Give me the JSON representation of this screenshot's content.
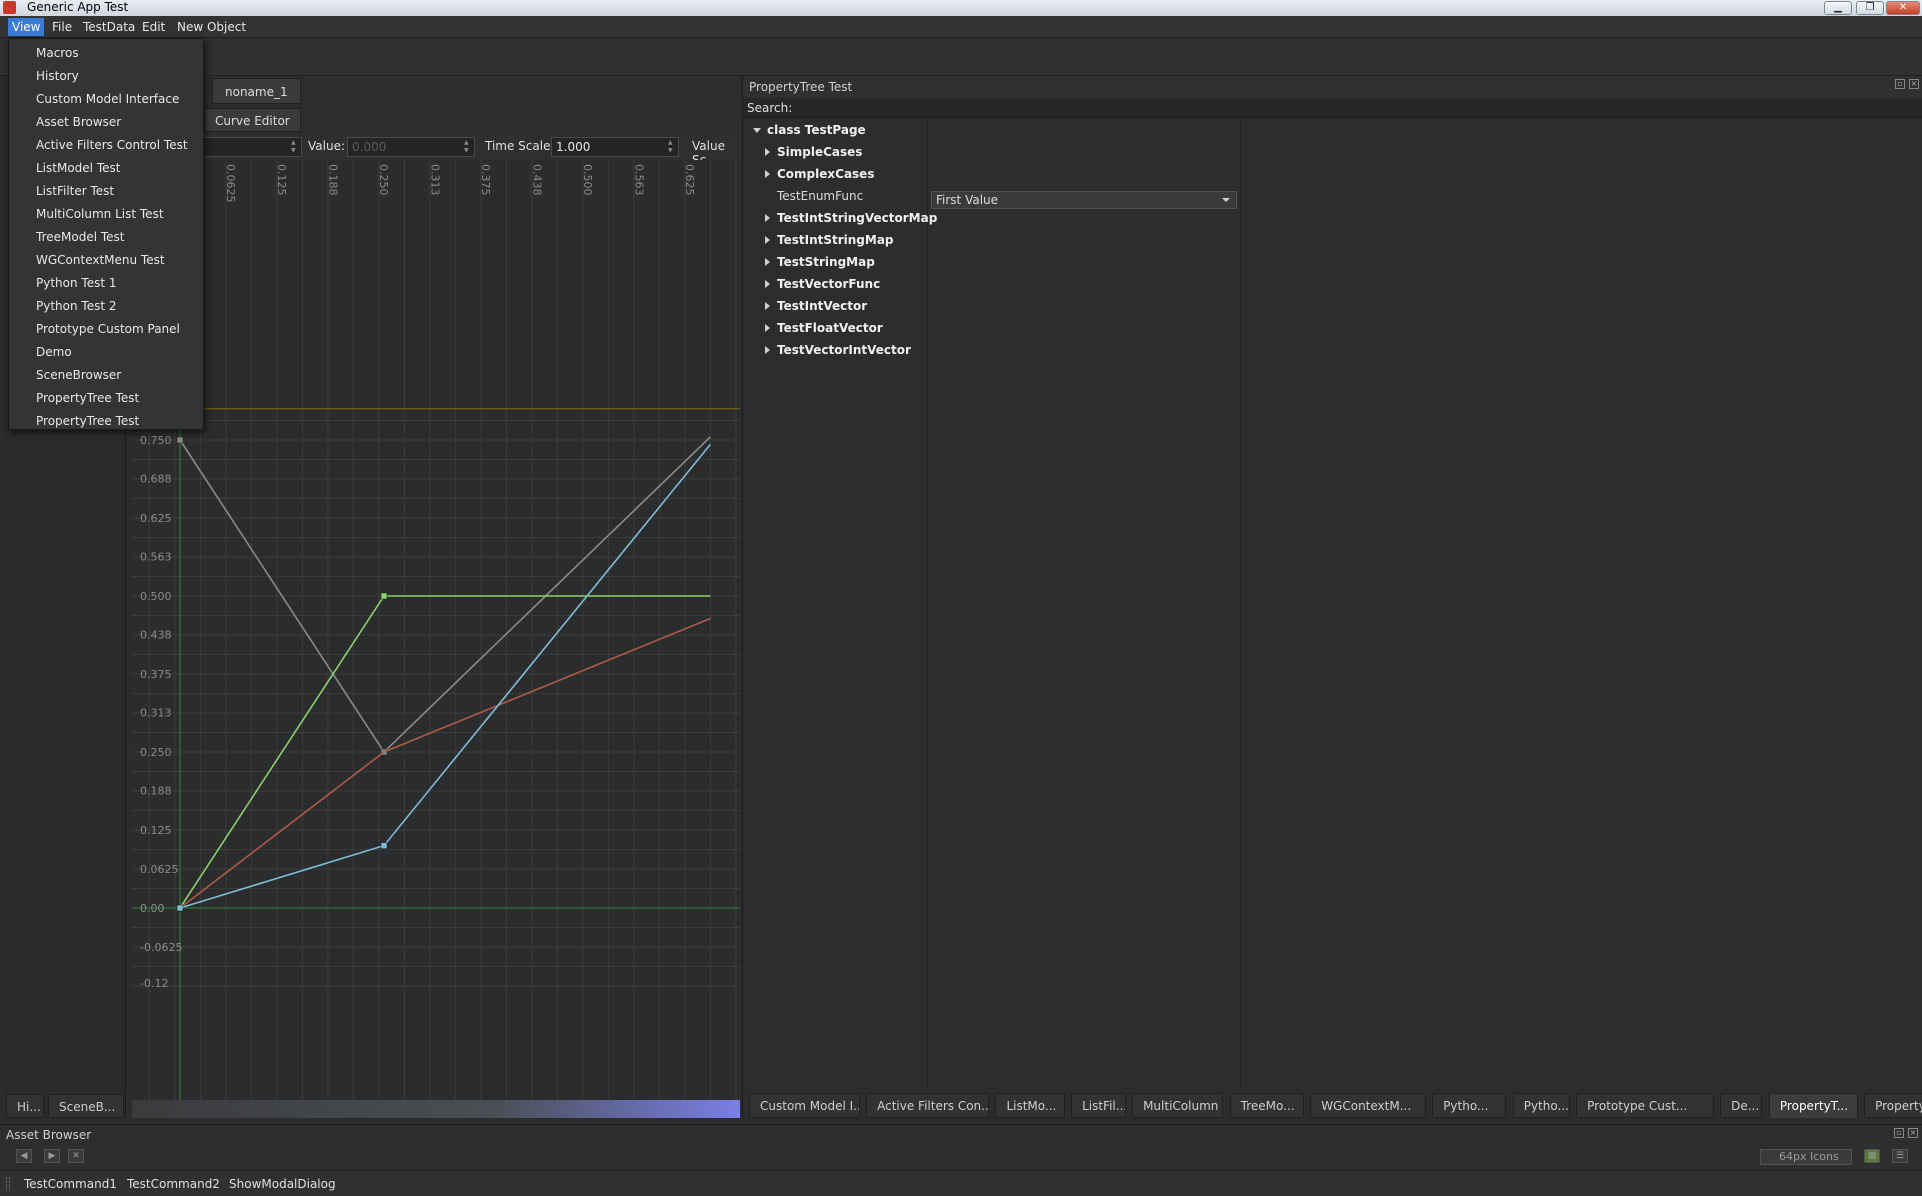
{
  "window": {
    "title": "Generic App Test"
  },
  "menubar": {
    "items": [
      "View",
      "File",
      "TestData",
      "Edit",
      "New Object"
    ]
  },
  "view_menu": {
    "items": [
      "Macros",
      "History",
      "Custom Model Interface",
      "Asset Browser",
      "Active Filters Control Test",
      "ListModel Test",
      "ListFilter Test",
      "MultiColumn List Test",
      "TreeModel Test",
      "WGContextMenu Test",
      "Python Test 1",
      "Python Test 2",
      "Prototype Custom Panel",
      "Demo",
      "SceneBrowser",
      "PropertyTree Test",
      "PropertyTree Test"
    ]
  },
  "left_dock": {
    "tabs": [
      "Hi...",
      "SceneB..."
    ]
  },
  "center": {
    "doc_tab": "noname_1",
    "sub_tab": "Curve Editor",
    "value_label": "Value:",
    "value": "0.000",
    "time_scale_label": "Time Scale:",
    "time_scale": "1.000",
    "value_scale_label": "Value Sc"
  },
  "chart_data": {
    "type": "line",
    "x_ticks": [
      "0.0625",
      "0.125",
      "0.188",
      "0.250",
      "0.313",
      "0.375",
      "0.438",
      "0.500",
      "0.563",
      "0.625"
    ],
    "y_ticks": [
      "0.750",
      "0.688",
      "0.625",
      "0.563",
      "0.500",
      "0.438",
      "0.375",
      "0.313",
      "0.250",
      "0.188",
      "0.125",
      "0.0625",
      "0.00",
      "-0.0625",
      "-0.12"
    ],
    "xlim": [
      0,
      0.65
    ],
    "ylim": [
      -0.125,
      0.8
    ],
    "series": [
      {
        "color": "#8a8a8a",
        "points": [
          [
            0,
            0.75
          ],
          [
            0.25,
            0.25
          ],
          [
            0.65,
            0.755
          ]
        ],
        "keys": [
          [
            0,
            0.75
          ],
          [
            0.25,
            0.25
          ]
        ]
      },
      {
        "color": "#8ed16b",
        "points": [
          [
            0,
            0
          ],
          [
            0.25,
            0.5
          ],
          [
            0.65,
            0.5
          ]
        ],
        "keys": [
          [
            0,
            0
          ],
          [
            0.25,
            0.5
          ]
        ]
      },
      {
        "color": "#b05a4a",
        "points": [
          [
            0,
            0
          ],
          [
            0.25,
            0.25
          ],
          [
            0.65,
            0.464
          ]
        ],
        "keys": []
      },
      {
        "color": "#7fbcd6",
        "points": [
          [
            0,
            0
          ],
          [
            0.25,
            0.1
          ],
          [
            0.65,
            0.743
          ]
        ],
        "keys": [
          [
            0,
            0
          ],
          [
            0.25,
            0.1
          ]
        ]
      }
    ],
    "hline": {
      "value": 0.8,
      "color": "#8a6a1a"
    },
    "grid": true
  },
  "property_panel": {
    "title": "PropertyTree Test",
    "search_label": "Search:",
    "root": "class TestPage",
    "items": [
      {
        "label": "SimpleCases",
        "expandable": true
      },
      {
        "label": "ComplexCases",
        "expandable": true
      },
      {
        "label": "TestEnumFunc",
        "expandable": false,
        "value": "First Value"
      },
      {
        "label": "TestIntStringVectorMap",
        "expandable": true
      },
      {
        "label": "TestIntStringMap",
        "expandable": true
      },
      {
        "label": "TestStringMap",
        "expandable": true
      },
      {
        "label": "TestVectorFunc",
        "expandable": true
      },
      {
        "label": "TestIntVector",
        "expandable": true
      },
      {
        "label": "TestFloatVector",
        "expandable": true
      },
      {
        "label": "TestVectorIntVector",
        "expandable": true
      }
    ],
    "bottom_tabs": [
      "Custom Model I...",
      "Active Filters Con...",
      "ListMo...",
      "ListFil...",
      "MultiColumn ...",
      "TreeMo...",
      "WGContextM...",
      "Pytho...",
      "Pytho...",
      "Prototype Cust...",
      "De...",
      "PropertyT...",
      "PropertyT..."
    ],
    "selected_tab": 11
  },
  "asset_browser": {
    "title": "Asset Browser",
    "icon_size": "64px Icons"
  },
  "status_bar": {
    "items": [
      "TestCommand1",
      "TestCommand2",
      "ShowModalDialog"
    ]
  }
}
